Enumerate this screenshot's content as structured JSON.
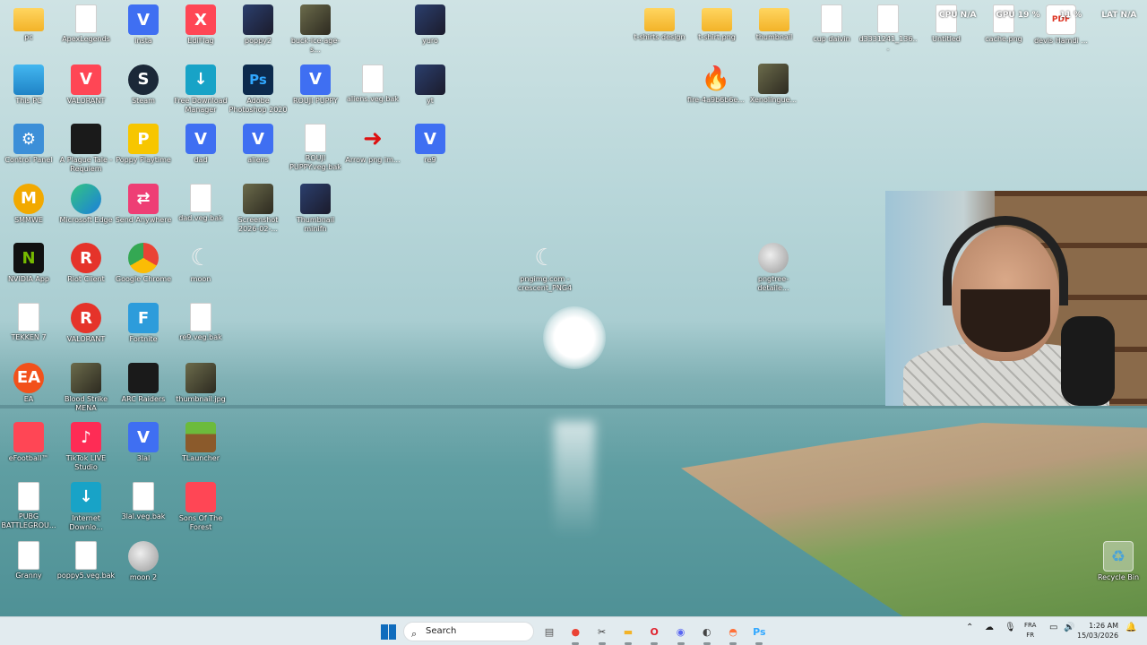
{
  "desktop_icons": [
    {
      "label": "pc",
      "icon": "folder-icon",
      "cls": "i-folder",
      "glyph": "",
      "col": 0,
      "row": 0
    },
    {
      "label": "ApexLegends",
      "icon": "file-icon",
      "cls": "i-file",
      "glyph": "",
      "col": 1,
      "row": 0
    },
    {
      "label": "insta",
      "icon": "video-editor-icon",
      "cls": "i-v",
      "glyph": "V",
      "col": 2,
      "row": 0
    },
    {
      "label": "EdiFlag",
      "icon": "editor-x-icon",
      "cls": "i-val",
      "glyph": "X",
      "col": 3,
      "row": 0
    },
    {
      "label": "poppy2",
      "icon": "image-thumbnail-icon",
      "cls": "i-photo2",
      "glyph": "",
      "col": 4,
      "row": 0
    },
    {
      "label": "buck-ice-age-s...",
      "icon": "image-thumbnail-icon",
      "cls": "i-photo",
      "glyph": "",
      "col": 5,
      "row": 0
    },
    {
      "label": "yuro",
      "icon": "image-thumbnail-icon",
      "cls": "i-photo2",
      "glyph": "",
      "col": 7,
      "row": 0
    },
    {
      "label": "This PC",
      "icon": "computer-icon",
      "cls": "i-pc",
      "glyph": "",
      "col": 0,
      "row": 1
    },
    {
      "label": "VALORANT",
      "icon": "valorant-icon",
      "cls": "i-val",
      "glyph": "V",
      "col": 1,
      "row": 1
    },
    {
      "label": "Steam",
      "icon": "steam-icon",
      "cls": "i-steam",
      "glyph": "S",
      "col": 2,
      "row": 1
    },
    {
      "label": "Free Download Manager",
      "icon": "download-manager-icon",
      "cls": "i-dl",
      "glyph": "↓",
      "col": 3,
      "row": 1
    },
    {
      "label": "Adobe Photoshop 2020",
      "icon": "photoshop-icon",
      "cls": "i-ps",
      "glyph": "Ps",
      "col": 4,
      "row": 1
    },
    {
      "label": "ROUJI PUPPY",
      "icon": "video-editor-icon",
      "cls": "i-v",
      "glyph": "V",
      "col": 5,
      "row": 1
    },
    {
      "label": "aliens.veg.bak",
      "icon": "file-icon",
      "cls": "i-file",
      "glyph": "",
      "col": 6,
      "row": 1
    },
    {
      "label": "yt",
      "icon": "image-thumbnail-icon",
      "cls": "i-photo2",
      "glyph": "",
      "col": 7,
      "row": 1
    },
    {
      "label": "Control Panel",
      "icon": "control-panel-icon",
      "cls": "i-cpanel",
      "glyph": "⚙",
      "col": 0,
      "row": 2
    },
    {
      "label": "A Plague Tale - Requiem",
      "icon": "game-icon",
      "cls": "i-plague",
      "glyph": "",
      "col": 1,
      "row": 2
    },
    {
      "label": "Poppy Playtime",
      "icon": "poppy-playtime-icon",
      "cls": "i-poppy",
      "glyph": "P",
      "col": 2,
      "row": 2
    },
    {
      "label": "dad",
      "icon": "video-editor-icon",
      "cls": "i-v",
      "glyph": "V",
      "col": 3,
      "row": 2
    },
    {
      "label": "aliens",
      "icon": "video-editor-icon",
      "cls": "i-v",
      "glyph": "V",
      "col": 4,
      "row": 2
    },
    {
      "label": "ROUJI PUPPY.veg.bak",
      "icon": "file-icon",
      "cls": "i-file",
      "glyph": "",
      "col": 5,
      "row": 2
    },
    {
      "label": "Arrow png im...",
      "icon": "arrow-image-icon",
      "cls": "i-arrow",
      "glyph": "➜",
      "col": 6,
      "row": 2
    },
    {
      "label": "re9",
      "icon": "video-editor-icon",
      "cls": "i-v",
      "glyph": "V",
      "col": 7,
      "row": 2
    },
    {
      "label": "SMMWE",
      "icon": "smmwe-icon",
      "cls": "i-smm",
      "glyph": "M",
      "col": 0,
      "row": 3
    },
    {
      "label": "Microsoft Edge",
      "icon": "edge-icon",
      "cls": "i-edge",
      "glyph": "",
      "col": 1,
      "row": 3
    },
    {
      "label": "Send Anywhere",
      "icon": "send-anywhere-icon",
      "cls": "i-pink",
      "glyph": "⇄",
      "col": 2,
      "row": 3
    },
    {
      "label": "dad.veg.bak",
      "icon": "file-icon",
      "cls": "i-file",
      "glyph": "",
      "col": 3,
      "row": 3
    },
    {
      "label": "Screenshot 2026-02-...",
      "icon": "image-thumbnail-icon",
      "cls": "i-photo",
      "glyph": "",
      "col": 4,
      "row": 3
    },
    {
      "label": "Thumbnail minifn",
      "icon": "image-thumbnail-icon",
      "cls": "i-photo2",
      "glyph": "",
      "col": 5,
      "row": 3
    },
    {
      "label": "NVIDIA App",
      "icon": "nvidia-icon",
      "cls": "i-nvidia",
      "glyph": "N",
      "col": 0,
      "row": 4
    },
    {
      "label": "Riot Client",
      "icon": "riot-client-icon",
      "cls": "i-red",
      "glyph": "R",
      "col": 1,
      "row": 4
    },
    {
      "label": "Google Chrome",
      "icon": "chrome-icon",
      "cls": "i-chrome",
      "glyph": "",
      "col": 2,
      "row": 4
    },
    {
      "label": "moon",
      "icon": "crescent-moon-icon",
      "cls": "i-crescent",
      "glyph": "☾",
      "col": 3,
      "row": 4
    },
    {
      "label": "TEKKEN 7",
      "icon": "file-icon",
      "cls": "i-file",
      "glyph": "",
      "col": 0,
      "row": 5
    },
    {
      "label": "VALORANT",
      "icon": "riot-client-icon",
      "cls": "i-red",
      "glyph": "R",
      "col": 1,
      "row": 5
    },
    {
      "label": "Fortnite",
      "icon": "fortnite-icon",
      "cls": "i-fort",
      "glyph": "F",
      "col": 2,
      "row": 5
    },
    {
      "label": "re9.veg.bak",
      "icon": "file-icon",
      "cls": "i-file",
      "glyph": "",
      "col": 3,
      "row": 5
    },
    {
      "label": "EA",
      "icon": "ea-icon",
      "cls": "i-ea",
      "glyph": "EA",
      "col": 0,
      "row": 6
    },
    {
      "label": "Blood Strike MENA",
      "icon": "game-icon",
      "cls": "i-photo",
      "glyph": "",
      "col": 1,
      "row": 6
    },
    {
      "label": "ARC Raiders",
      "icon": "arc-raiders-icon",
      "cls": "i-plague",
      "glyph": "",
      "col": 2,
      "row": 6
    },
    {
      "label": "thumbnail.jpg",
      "icon": "image-thumbnail-icon",
      "cls": "i-photo",
      "glyph": "",
      "col": 3,
      "row": 6
    },
    {
      "label": "eFootball™",
      "icon": "game-icon",
      "cls": "i-val",
      "glyph": "",
      "col": 0,
      "row": 7
    },
    {
      "label": "TikTok LIVE Studio",
      "icon": "tiktok-icon",
      "cls": "i-tiktok",
      "glyph": "♪",
      "col": 1,
      "row": 7
    },
    {
      "label": "3lal",
      "icon": "video-editor-icon",
      "cls": "i-v",
      "glyph": "V",
      "col": 2,
      "row": 7
    },
    {
      "label": "TLauncher",
      "icon": "minecraft-icon",
      "cls": "i-mc",
      "glyph": "",
      "col": 3,
      "row": 7
    },
    {
      "label": "PUBG BATTLEGROU...",
      "icon": "file-icon",
      "cls": "i-file",
      "glyph": "",
      "col": 0,
      "row": 8
    },
    {
      "label": "Internet Downlo...",
      "icon": "internet-download-icon",
      "cls": "i-dl",
      "glyph": "↓",
      "col": 1,
      "row": 8
    },
    {
      "label": "3lal.veg.bak",
      "icon": "file-icon",
      "cls": "i-file",
      "glyph": "",
      "col": 2,
      "row": 8
    },
    {
      "label": "Sons Of The Forest",
      "icon": "game-icon",
      "cls": "i-val",
      "glyph": "",
      "col": 3,
      "row": 8
    },
    {
      "label": "Granny",
      "icon": "file-icon",
      "cls": "i-file",
      "glyph": "",
      "col": 0,
      "row": 9
    },
    {
      "label": "poppy5.veg.bak",
      "icon": "file-icon",
      "cls": "i-file",
      "glyph": "",
      "col": 1,
      "row": 9
    },
    {
      "label": "moon 2",
      "icon": "moon-icon",
      "cls": "i-moon",
      "glyph": "",
      "col": 2,
      "row": 9
    }
  ],
  "free_icons": [
    {
      "label": "t-shirts design",
      "icon": "folder-icon",
      "cls": "i-folder",
      "glyph": "",
      "spot": "a"
    },
    {
      "label": "t-shirt.png",
      "icon": "folder-icon",
      "cls": "i-folder",
      "glyph": "",
      "spot": "b"
    },
    {
      "label": "thumbnail",
      "icon": "folder-icon",
      "cls": "i-folder",
      "glyph": "",
      "spot": "c"
    },
    {
      "label": "cup daivin",
      "icon": "file-icon",
      "cls": "i-file",
      "glyph": "",
      "spot": "d"
    },
    {
      "label": "d3331241_136...",
      "icon": "document-thumbnail-icon",
      "cls": "i-file",
      "glyph": "",
      "spot": "e"
    },
    {
      "label": "Untitled",
      "icon": "app-icon",
      "cls": "i-file",
      "glyph": "",
      "spot": "f"
    },
    {
      "label": "cache.png",
      "icon": "app-icon",
      "cls": "i-file",
      "glyph": "",
      "spot": "g"
    },
    {
      "label": "devis Hamdi ...",
      "icon": "pdf-icon",
      "cls": "i-pdf",
      "glyph": "PDF",
      "spot": "h"
    },
    {
      "label": "fire-4a9b6b6e...",
      "icon": "fire-icon",
      "cls": "i-fire",
      "glyph": "🔥",
      "spot": "i"
    },
    {
      "label": "Xenolingue...",
      "icon": "image-thumbnail-icon",
      "cls": "i-photo",
      "glyph": "",
      "spot": "j"
    },
    {
      "label": "pngimg.com - crescent_PNG4",
      "icon": "crescent-moon-icon",
      "cls": "i-crescent",
      "glyph": "☾",
      "spot": "k"
    },
    {
      "label": "pngtree-detaile...",
      "icon": "moon-icon",
      "cls": "i-moon",
      "glyph": "",
      "spot": "l"
    },
    {
      "label": "Recycle Bin",
      "icon": "recycle-bin-icon",
      "cls": "i-recycle",
      "glyph": "♻",
      "spot": "m"
    }
  ],
  "overlay": {
    "gpu_label": "GPU",
    "gpu_value": "19 %",
    "cpu_label": "CPU",
    "cpu_value": "N/A",
    "mem_value": "11 %",
    "lat_label": "LAT",
    "lat_value": "N/A"
  },
  "taskbar": {
    "search_placeholder": "Search",
    "apps": [
      {
        "name": "file-explorer-taskbar-icon",
        "glyph": "▤",
        "color": "#555"
      },
      {
        "name": "chrome-taskbar-icon",
        "glyph": "●",
        "color": "#ea4335"
      },
      {
        "name": "snipping-tool-taskbar-icon",
        "glyph": "✂",
        "color": "#333"
      },
      {
        "name": "folder-taskbar-icon",
        "glyph": "▬",
        "color": "#f3b328"
      },
      {
        "name": "opera-taskbar-icon",
        "glyph": "O",
        "color": "#e0232e"
      },
      {
        "name": "discord-taskbar-icon",
        "glyph": "◉",
        "color": "#5865f2"
      },
      {
        "name": "riot-taskbar-icon",
        "glyph": "◐",
        "color": "#444"
      },
      {
        "name": "firefox-taskbar-icon",
        "glyph": "◓",
        "color": "#ff7139"
      },
      {
        "name": "photoshop-taskbar-icon",
        "glyph": "Ps",
        "color": "#31a8ff"
      }
    ],
    "lang_line1": "FRA",
    "lang_line2": "FR",
    "time": "1:26 AM",
    "date": "15/03/2026"
  }
}
